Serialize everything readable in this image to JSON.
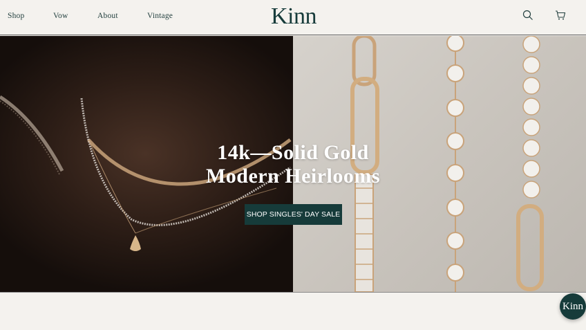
{
  "nav": {
    "links": [
      {
        "label": "Shop"
      },
      {
        "label": "Vow"
      },
      {
        "label": "About"
      },
      {
        "label": "Vintage"
      }
    ],
    "logo": "Kinn",
    "icons": {
      "search": "search-icon",
      "cart": "cart-icon"
    }
  },
  "hero": {
    "title_line1": "14k—Solid Gold",
    "title_line2": "Modern Heirlooms",
    "cta_label": "SHOP SINGLES' DAY SALE"
  },
  "chat": {
    "label": "Kinn"
  },
  "colors": {
    "brand": "#163b3a",
    "background": "#f4f2ee"
  }
}
